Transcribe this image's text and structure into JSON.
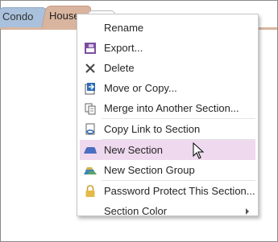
{
  "tabs": [
    {
      "label": "Condo",
      "color": "#a9c1dc"
    },
    {
      "label": "House",
      "color": "#d9b59f"
    }
  ],
  "menu": {
    "items": [
      {
        "label": "Rename",
        "icon": "none-icon"
      },
      {
        "label": "Export...",
        "icon": "export-icon"
      },
      {
        "label": "Delete",
        "icon": "delete-x-icon"
      },
      {
        "label": "Move or Copy...",
        "icon": "move-copy-icon"
      },
      {
        "label": "Merge into Another Section...",
        "icon": "merge-icon"
      },
      {
        "label": "Copy Link to Section",
        "icon": "copy-link-icon"
      },
      {
        "label": "New Section",
        "icon": "new-section-icon",
        "highlighted": true
      },
      {
        "label": "New Section Group",
        "icon": "new-section-group-icon"
      },
      {
        "label": "Password Protect This Section...",
        "icon": "lock-icon"
      },
      {
        "label": "Section Color",
        "icon": "none-icon",
        "submenu": true
      }
    ],
    "highlight_color": "#efd9ee"
  }
}
